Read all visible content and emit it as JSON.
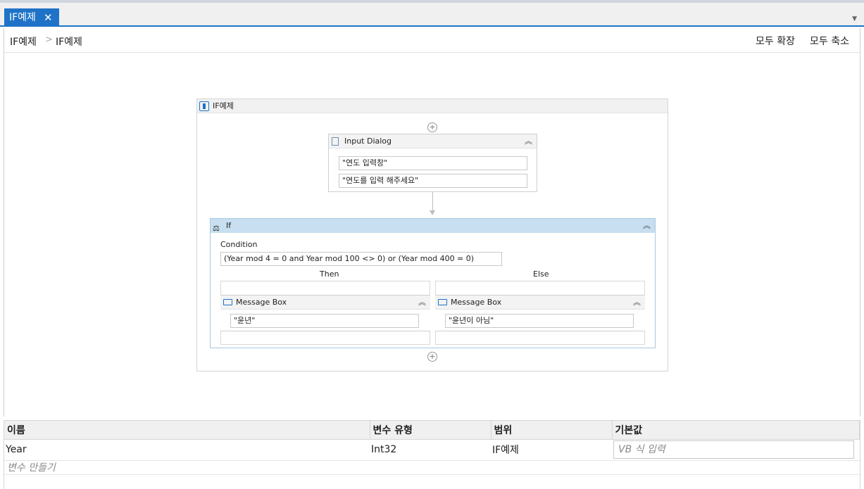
{
  "tab": {
    "title": "IF예제",
    "close": "✕",
    "dropdown": "▼"
  },
  "breadcrumb": {
    "items": [
      "IF예제",
      "IF예제"
    ],
    "separator": ">"
  },
  "toolbar": {
    "expand_all": "모두 확장",
    "collapse_all": "모두 축소"
  },
  "sequence": {
    "title": "IF예제",
    "add": "+"
  },
  "input_dialog": {
    "title": "Input Dialog",
    "collapse": "︽",
    "title_field": "\"연도 입력창\"",
    "label_field": "\"연도를 입력 해주세요\""
  },
  "if_activity": {
    "title": "If",
    "collapse": "︽",
    "condition_label": "Condition",
    "condition_value": "(Year mod 4 = 0 and Year mod 100 <> 0) or (Year mod 400 = 0)",
    "then_label": "Then",
    "else_label": "Else",
    "then_box": {
      "title": "Message Box",
      "collapse": "︽",
      "text": "\"윤년\""
    },
    "else_box": {
      "title": "Message Box",
      "collapse": "︽",
      "text": "\"윤년이 아님\""
    }
  },
  "variables": {
    "headers": [
      "이름",
      "변수 유형",
      "범위",
      "기본값"
    ],
    "rows": [
      {
        "name": "Year",
        "type": "Int32",
        "scope": "IF예제",
        "default_placeholder": "VB 식 입력"
      }
    ],
    "create_label": "변수 만들기"
  },
  "colors": {
    "accent": "#1e73c8",
    "if_header": "#c7dff0"
  }
}
